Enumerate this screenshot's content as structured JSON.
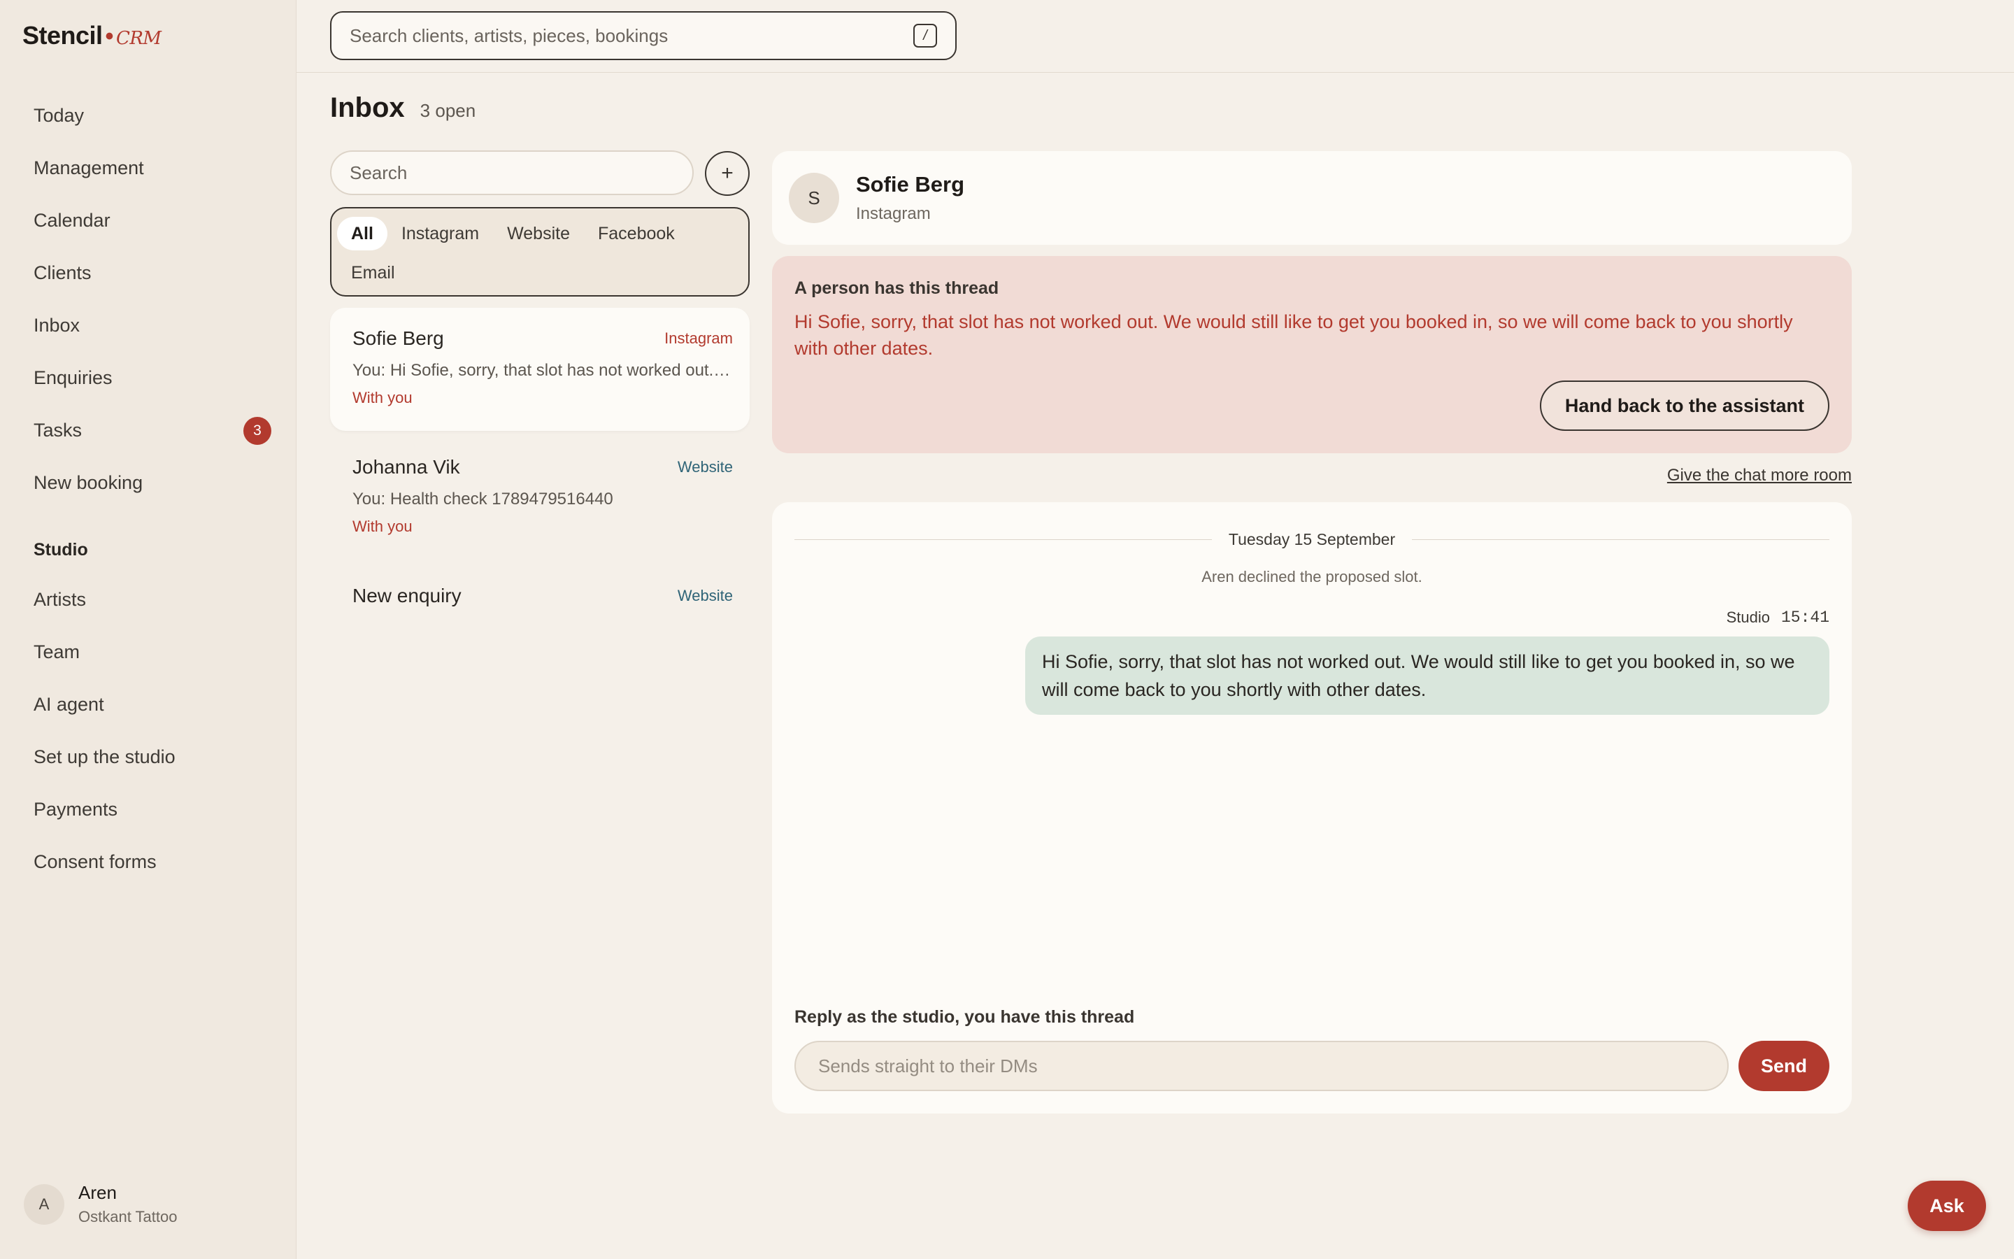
{
  "brand": {
    "name": "Stencil",
    "suffix": "CRM",
    "accent": "#b23a2e"
  },
  "search": {
    "placeholder": "Search clients, artists, pieces, bookings",
    "shortcut": "/"
  },
  "sidebar": {
    "items": [
      {
        "label": "Today"
      },
      {
        "label": "Management"
      },
      {
        "label": "Calendar"
      },
      {
        "label": "Clients"
      },
      {
        "label": "Inbox"
      },
      {
        "label": "Enquiries"
      },
      {
        "label": "Tasks",
        "badge": "3"
      },
      {
        "label": "New booking"
      }
    ],
    "section_title": "Studio",
    "studio_items": [
      {
        "label": "Artists"
      },
      {
        "label": "Team"
      },
      {
        "label": "AI agent"
      },
      {
        "label": "Set up the studio"
      },
      {
        "label": "Payments"
      },
      {
        "label": "Consent forms"
      }
    ],
    "user": {
      "initial": "A",
      "name": "Aren",
      "studio": "Ostkant Tattoo"
    }
  },
  "inbox": {
    "title": "Inbox",
    "open_count": "3 open",
    "search_placeholder": "Search",
    "add_label": "+",
    "filters": [
      "All",
      "Instagram",
      "Website",
      "Facebook",
      "Email"
    ],
    "active_filter": "All",
    "threads": [
      {
        "name": "Sofie Berg",
        "source": "Instagram",
        "preview": "You: Hi Sofie, sorry, that slot has not worked out. We would still like to get you booked in",
        "status": "With you"
      },
      {
        "name": "Johanna Vik",
        "source": "Website",
        "preview": "You: Health check 1789479516440",
        "status": "With you"
      },
      {
        "name": "New enquiry",
        "source": "Website"
      }
    ]
  },
  "conversation": {
    "contact": {
      "initial": "S",
      "name": "Sofie Berg",
      "source": "Instagram"
    },
    "takeover": {
      "title": "A person has this thread",
      "text": "Hi Sofie, sorry, that slot has not worked out. We would still like to get you booked in, so we will come back to you shortly with other dates.",
      "button": "Hand back to the assistant"
    },
    "more_room_link": "Give the chat more room",
    "date_divider": "Tuesday 15 September",
    "system_note": "Aren declined the proposed slot.",
    "message": {
      "sender": "Studio",
      "time": "15:41",
      "text": "Hi Sofie, sorry, that slot has not worked out. We would still like to get you booked in, so we will come back to you shortly with other dates."
    },
    "reply": {
      "label": "Reply as the studio, you have this thread",
      "placeholder": "Sends straight to their DMs",
      "send": "Send"
    }
  },
  "ask_button": "Ask",
  "colors": {
    "accent": "#b23a2e",
    "background": "#f5f0e9",
    "sidebar": "#f0e9e0",
    "takeover_bg": "#f1dbd5",
    "bubble_bg": "#d9e6dc",
    "website_link": "#2f6477"
  }
}
